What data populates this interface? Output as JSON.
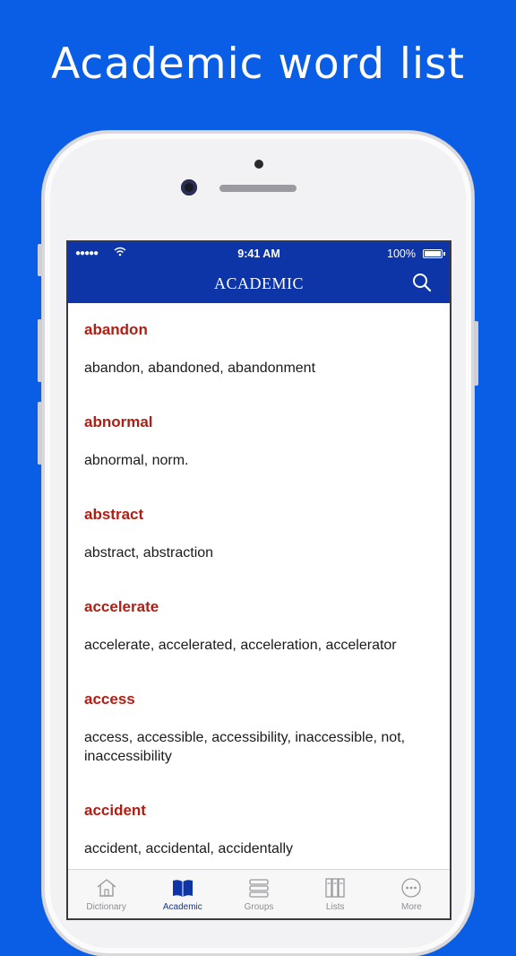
{
  "headline": "Academic word list",
  "status": {
    "time": "9:41 AM",
    "battery": "100%"
  },
  "nav": {
    "title": "ACADEMIC"
  },
  "entries": [
    {
      "word": "abandon",
      "forms": "abandon, abandoned, abandonment"
    },
    {
      "word": "abnormal",
      "forms": "abnormal, norm."
    },
    {
      "word": "abstract",
      "forms": "abstract, abstraction"
    },
    {
      "word": "accelerate",
      "forms": "accelerate, accelerated, acceleration, accelerator"
    },
    {
      "word": "access",
      "forms": "access, accessible, accessibility, inaccessible, not, inaccessibility"
    },
    {
      "word": "accident",
      "forms": "accident, accidental, accidentally"
    }
  ],
  "tabs": [
    {
      "label": "Dictionary",
      "icon": "house-icon"
    },
    {
      "label": "Academic",
      "icon": "book-icon",
      "active": true
    },
    {
      "label": "Groups",
      "icon": "stack-icon"
    },
    {
      "label": "Lists",
      "icon": "binders-icon"
    },
    {
      "label": "More",
      "icon": "more-icon"
    }
  ],
  "colors": {
    "background": "#0a5ee6",
    "nav": "#0d35a8",
    "word": "#b01e14"
  }
}
